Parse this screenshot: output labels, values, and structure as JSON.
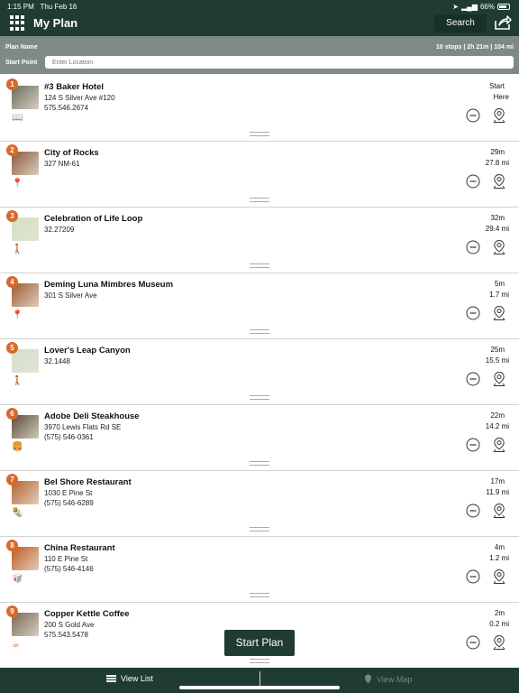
{
  "status": {
    "time": "1:15 PM",
    "date": "Thu Feb 16",
    "battery": "66%"
  },
  "header": {
    "title": "My Plan",
    "search_label": "Search"
  },
  "plan": {
    "name_label": "Plan Name",
    "summary": "10 stops | 2h 21m | 104 mi",
    "start_point_label": "Start Point",
    "location_placeholder": "Enter Location"
  },
  "stops": [
    {
      "num": "1",
      "name": "#3 Baker Hotel",
      "address": "124 S Silver Ave #120",
      "phone": "575.546.2674",
      "time": "Start",
      "dist": "Here",
      "category_icon": "book-icon",
      "thumb": "#6d6a5c"
    },
    {
      "num": "2",
      "name": "City of Rocks",
      "address": "327 NM-61",
      "phone": "",
      "time": "29m",
      "dist": "27.8 mi",
      "category_icon": "location-pin-icon",
      "thumb": "#8b5a3c"
    },
    {
      "num": "3",
      "name": "Celebration of Life Loop",
      "address": "32.27209",
      "phone": "",
      "time": "32m",
      "dist": "29.4 mi",
      "category_icon": "hiker-icon",
      "thumb": "#cfe1c4"
    },
    {
      "num": "4",
      "name": "Deming Luna Mimbres Museum",
      "address": "301 S Silver Ave",
      "phone": "",
      "time": "5m",
      "dist": "1.7 mi",
      "category_icon": "location-pin-icon",
      "thumb": "#a25833"
    },
    {
      "num": "5",
      "name": "Lover's Leap Canyon",
      "address": "32.1448",
      "phone": "",
      "time": "25m",
      "dist": "15.5 mi",
      "category_icon": "hiker-icon",
      "thumb": "#d3dfcb"
    },
    {
      "num": "6",
      "name": "Adobe Deli Steakhouse",
      "address": "3970 Lewis Flats Rd SE",
      "phone": "(575) 546-0361",
      "time": "22m",
      "dist": "14.2 mi",
      "category_icon": "burger-icon",
      "thumb": "#5b4a3a"
    },
    {
      "num": "7",
      "name": "Bel Shore Restaurant",
      "address": "1030 E Pine St",
      "phone": "(575) 546-6289",
      "time": "17m",
      "dist": "11.9 mi",
      "category_icon": "burrito-icon",
      "thumb": "#b3632f"
    },
    {
      "num": "8",
      "name": "China Restaurant",
      "address": "110 E Pine St",
      "phone": "(575) 546-4146",
      "time": "4m",
      "dist": "1.2 mi",
      "category_icon": "takeout-box-icon",
      "thumb": "#c15a21"
    },
    {
      "num": "9",
      "name": "Copper Kettle Coffee",
      "address": "200 S Gold Ave",
      "phone": "575.543.5478",
      "time": "2m",
      "dist": "0.2 mi",
      "category_icon": "coffee-cup-icon",
      "thumb": "#7a6654"
    }
  ],
  "buttons": {
    "start_plan": "Start Plan"
  },
  "tabs": {
    "view_list": "View List",
    "view_map": "View Map"
  },
  "colors": {
    "header_bg": "#1f3b34",
    "plan_bar_bg": "#7f8a87",
    "badge": "#d9692a",
    "accent": "#d9692a"
  }
}
